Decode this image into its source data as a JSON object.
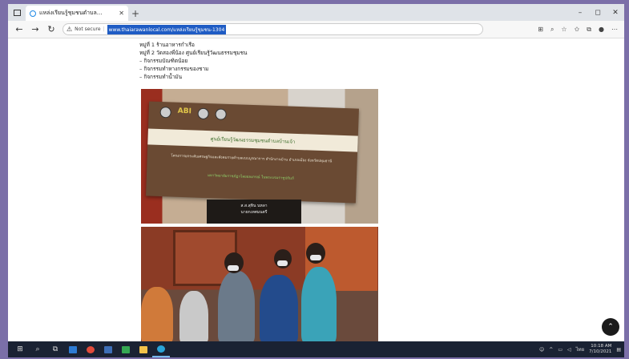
{
  "browser": {
    "tab_title": "แหล่งเรียนรู้ชุมชนตำบล...",
    "url": "www.thaiarawanlocal.com/แหล่งเรียนรู้ชุมชน-1304",
    "security_label": "Not secure",
    "window_controls": [
      "–",
      "◻",
      "✕"
    ]
  },
  "page": {
    "lines": [
      "หมู่ที่ 1 ร้านอาหารกำเรือ",
      "หมู่ที่ 2 วัดสองพี่น้อง ศูนย์เรียนรู้วัฒนธรรมชุมชน",
      "– กิจกรรมบัณฑิตน้อย",
      "– กิจกรรมทำหางกรรมของชาม",
      "– กิจกรรมทำน้ำมัน"
    ],
    "banner_logo_text": "ABI",
    "banner_title": "ศูนย์เรียนรู้วัฒนธรรมชุมชนตำบลบ้านเจ้า",
    "banner_desc": "โครงการยกระดับเศรษฐกิจและสังคมรายตำบลแบบบูรณาการ สำนักงานบ้าน อำเภอเมือง จังหวัดปทุมธานี",
    "banner_green": "มหาวิทยาลัยราชภัฏวไลยอลงกรณ์ ในพระบรมราชูปถัมภ์",
    "nameplate_line1": "ส.ส.สุทิน นหลา",
    "nameplate_line2": "นายกเทศมนตรี"
  },
  "taskbar": {
    "time": "10:18 AM",
    "date": "7/10/2021",
    "lang": "ไทย"
  },
  "colors": {
    "backdrop": "#7b6fa8",
    "url_highlight": "#1f5cc4",
    "taskbar": "#1a2233"
  }
}
